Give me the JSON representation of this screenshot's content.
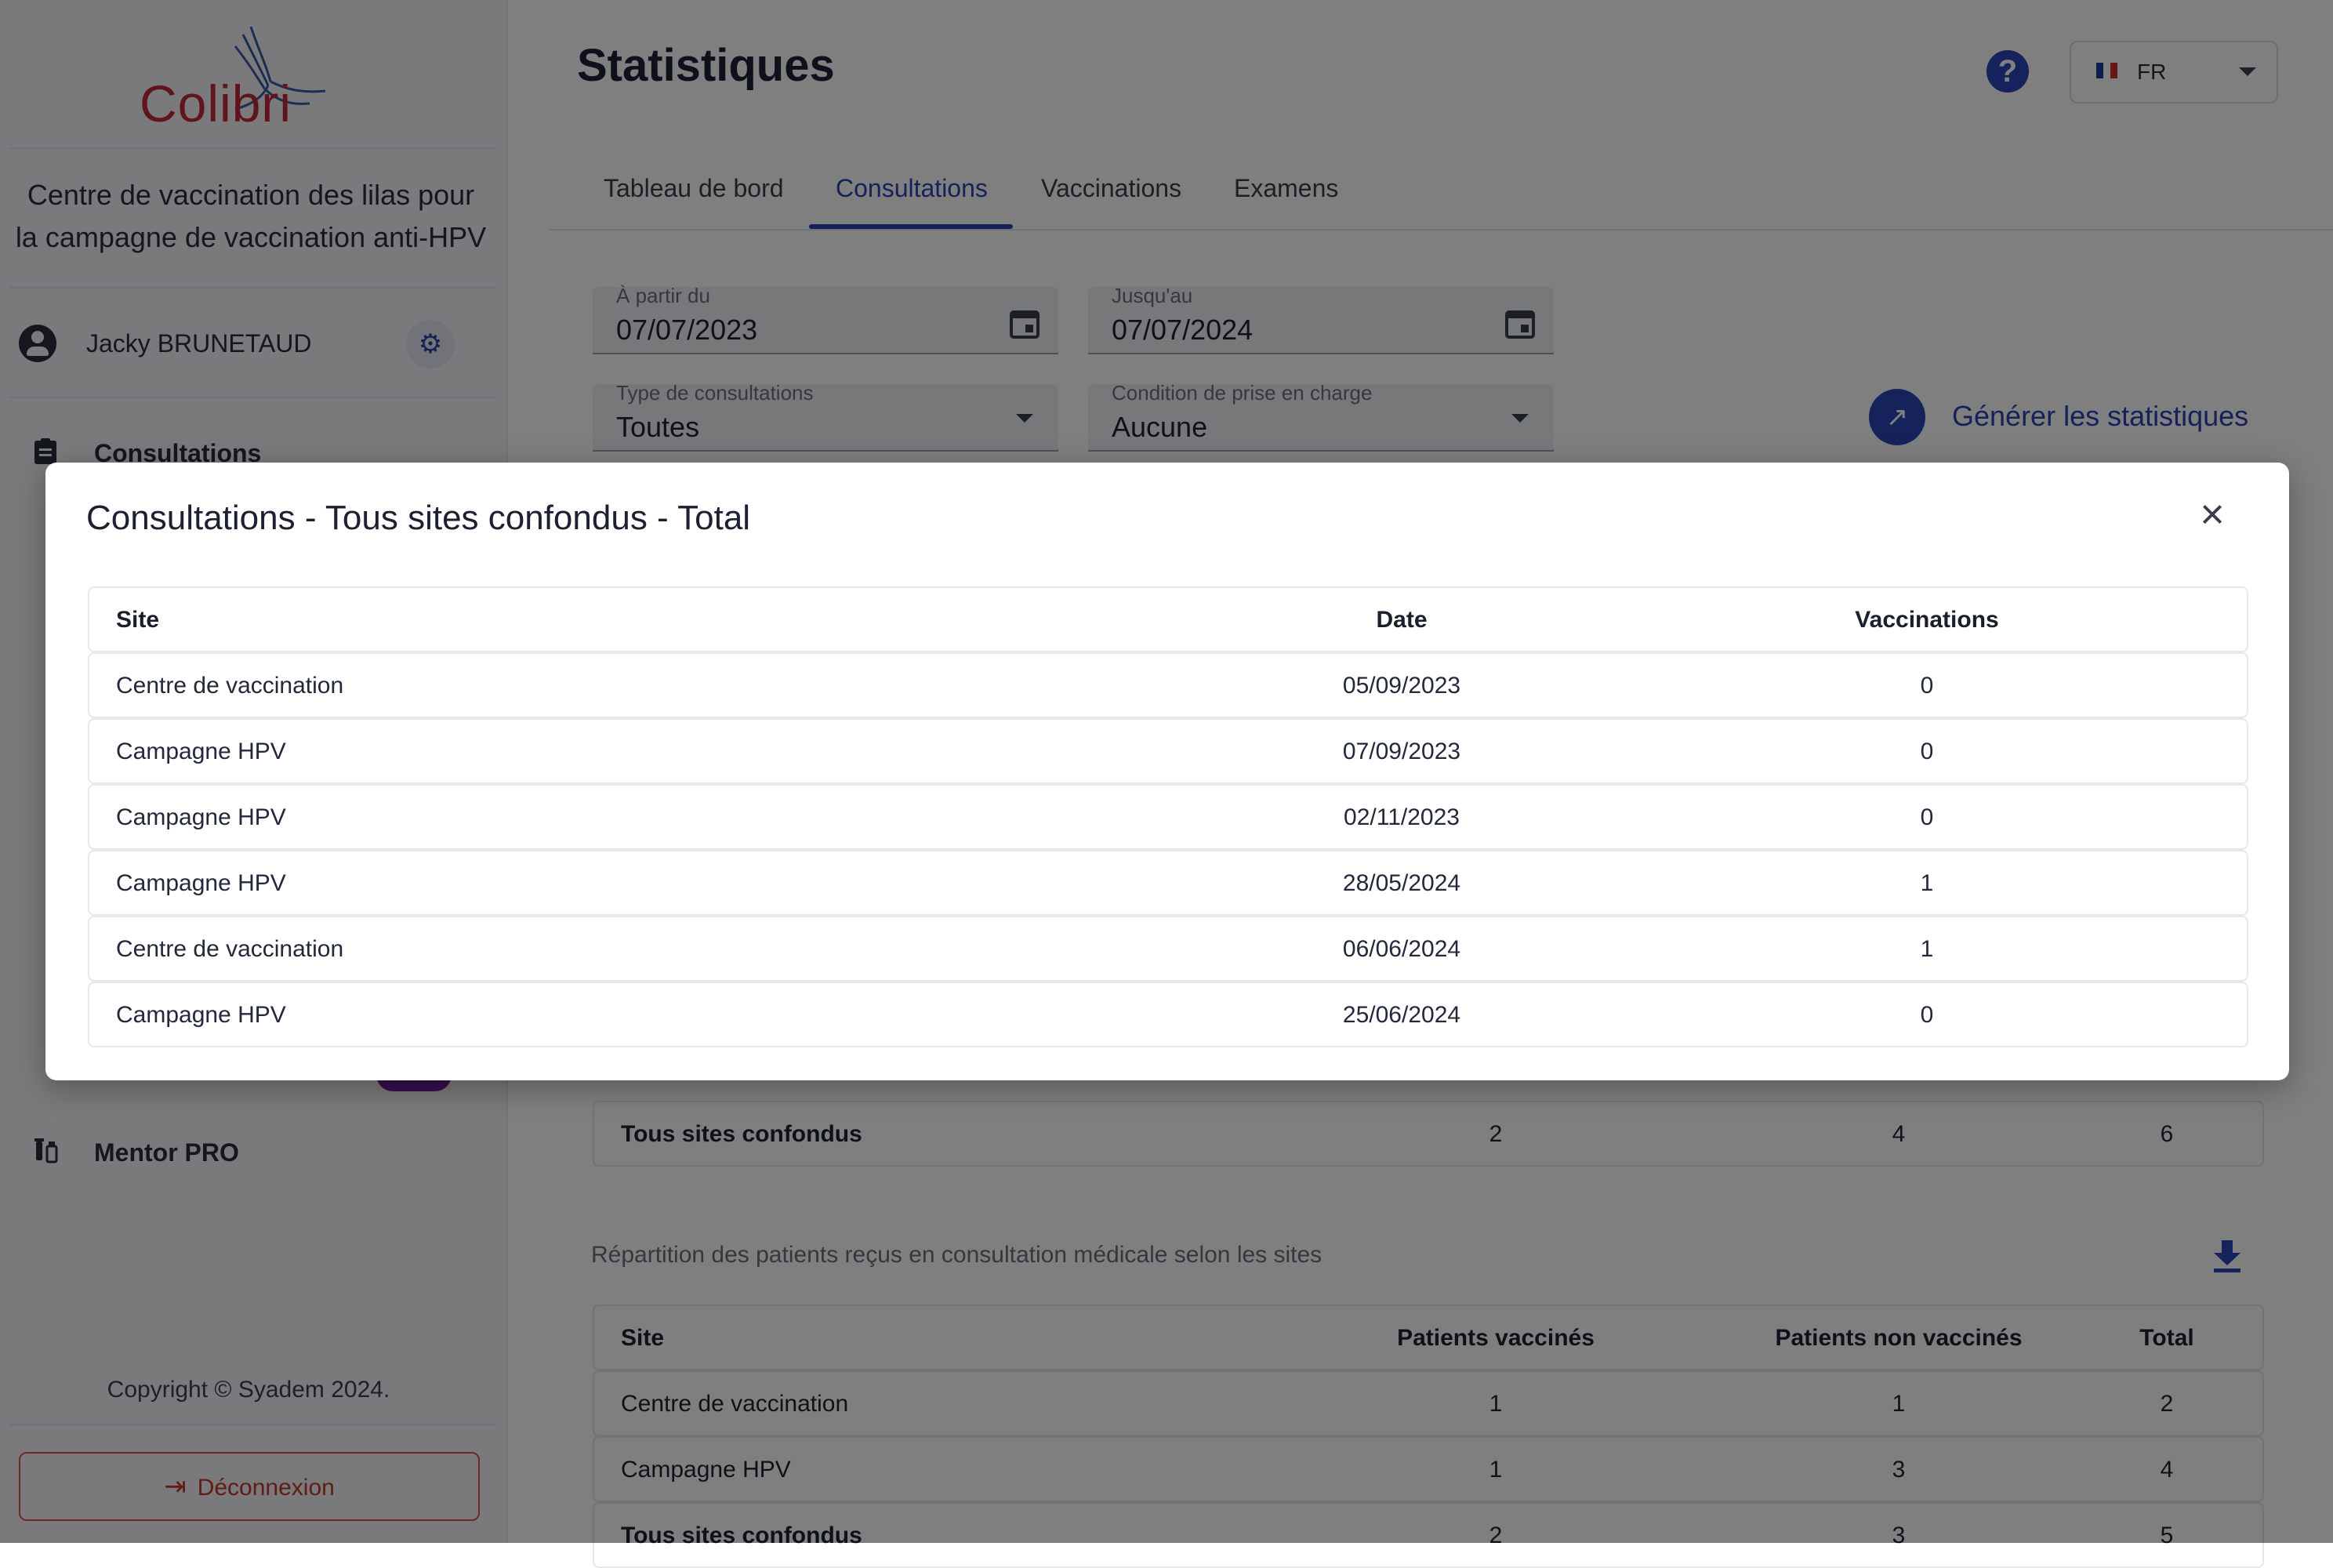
{
  "sidebar": {
    "logo_text": "Colibri",
    "center_name_line1": "Centre de vaccination des lilas pour",
    "center_name_line2": "la campagne de vaccination anti-HPV",
    "user_name": "Jacky BRUNETAUD",
    "nav": [
      {
        "label": "Consultations",
        "icon": "clipboard-icon"
      },
      {
        "label": "Mentor PRO",
        "icon": "vaccine-icon"
      }
    ],
    "copyright": "Copyright © Syadem 2024.",
    "logout_label": "Déconnexion"
  },
  "header": {
    "title": "Statistiques",
    "help_label": "?",
    "language": "FR"
  },
  "tabs": [
    {
      "label": "Tableau de bord",
      "active": false
    },
    {
      "label": "Consultations",
      "active": true
    },
    {
      "label": "Vaccinations",
      "active": false
    },
    {
      "label": "Examens",
      "active": false
    }
  ],
  "filters": {
    "from": {
      "label": "À partir du",
      "value": "07/07/2023"
    },
    "to": {
      "label": "Jusqu'au",
      "value": "07/07/2024"
    },
    "type": {
      "label": "Type de consultations",
      "value": "Toutes"
    },
    "condition": {
      "label": "Condition de prise en charge",
      "value": "Aucune"
    },
    "generate_label": "Générer les statistiques"
  },
  "first_table_total": {
    "site": "Tous sites confondus",
    "v1": "2",
    "v2": "4",
    "v3": "6"
  },
  "second_section": {
    "title": "Répartition des patients reçus en consultation médicale selon les sites",
    "headers": {
      "site": "Site",
      "vaccinated": "Patients vaccinés",
      "not_vaccinated": "Patients non vaccinés",
      "total": "Total"
    },
    "rows": [
      {
        "site": "Centre de vaccination",
        "vaccinated": "1",
        "not_vaccinated": "1",
        "total": "2"
      },
      {
        "site": "Campagne HPV",
        "vaccinated": "1",
        "not_vaccinated": "3",
        "total": "4"
      },
      {
        "site": "Tous sites confondus",
        "vaccinated": "2",
        "not_vaccinated": "3",
        "total": "5"
      }
    ]
  },
  "modal": {
    "title": "Consultations - Tous sites confondus - Total",
    "headers": {
      "site": "Site",
      "date": "Date",
      "vaccinations": "Vaccinations"
    },
    "rows": [
      {
        "site": "Centre de vaccination",
        "date": "05/09/2023",
        "vaccinations": "0"
      },
      {
        "site": "Campagne HPV",
        "date": "07/09/2023",
        "vaccinations": "0"
      },
      {
        "site": "Campagne HPV",
        "date": "02/11/2023",
        "vaccinations": "0"
      },
      {
        "site": "Campagne HPV",
        "date": "28/05/2024",
        "vaccinations": "1"
      },
      {
        "site": "Centre de vaccination",
        "date": "06/06/2024",
        "vaccinations": "1"
      },
      {
        "site": "Campagne HPV",
        "date": "25/06/2024",
        "vaccinations": "0"
      }
    ]
  },
  "colors": {
    "primary": "#2b44b8",
    "logo_red": "#c02a3a",
    "danger": "#c0392b",
    "badge": "#6f1fa0"
  }
}
